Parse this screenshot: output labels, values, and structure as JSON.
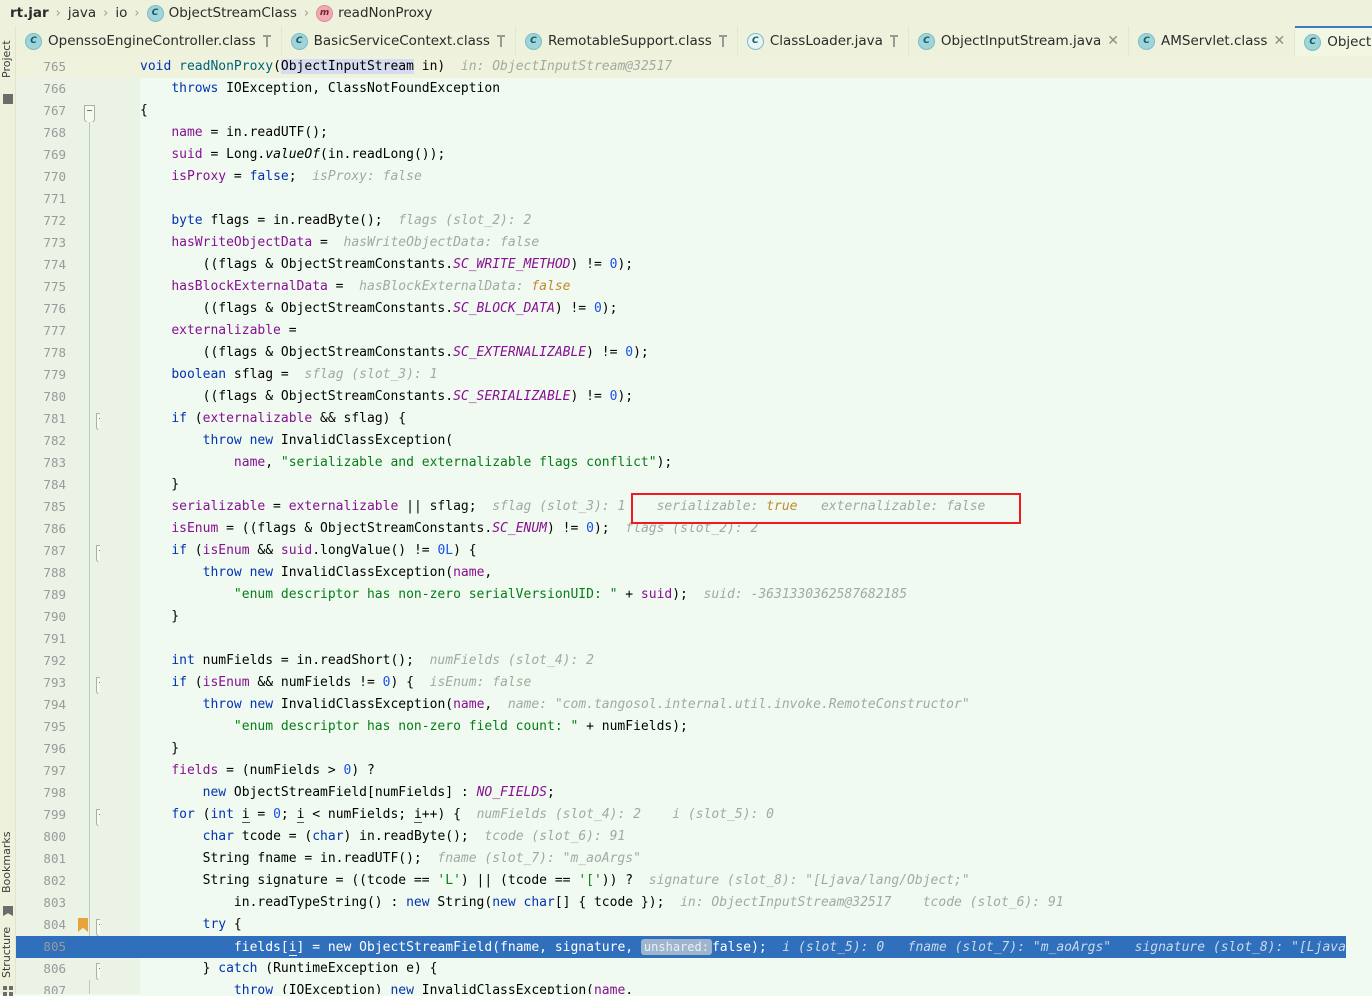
{
  "breadcrumb": {
    "items": [
      {
        "label": "rt.jar",
        "icon": "",
        "bold": true
      },
      {
        "label": "java",
        "icon": "",
        "bold": false
      },
      {
        "label": "io",
        "icon": "",
        "bold": false
      },
      {
        "label": "ObjectStreamClass",
        "icon": "class-icon",
        "bold": false
      },
      {
        "label": "readNonProxy",
        "icon": "method-icon",
        "bold": false
      }
    ],
    "separator": "›"
  },
  "tabs": [
    {
      "label": "OpenssoEngineController.class",
      "icon": "class-icon",
      "state": "pinned",
      "active": false
    },
    {
      "label": "BasicServiceContext.class",
      "icon": "class-icon",
      "state": "pinned",
      "active": false
    },
    {
      "label": "RemotableSupport.class",
      "icon": "class-icon",
      "state": "pinned",
      "active": false
    },
    {
      "label": "ClassLoader.java",
      "icon": "class-icon-outline",
      "state": "pinned",
      "active": false
    },
    {
      "label": "ObjectInputStream.java",
      "icon": "class-icon",
      "state": "closable",
      "active": false
    },
    {
      "label": "AMServlet.class",
      "icon": "class-icon",
      "state": "closable",
      "active": false
    },
    {
      "label": "ObjectStreamC",
      "icon": "class-icon",
      "state": "none",
      "active": true
    }
  ],
  "tool_windows": {
    "left_top": "Project",
    "left_bottom_1": "Bookmarks",
    "left_bottom_2": "Structure"
  },
  "annotations": {
    "red_box": {
      "serializable_label": "serializable: ",
      "serializable_value": "true",
      "externalizable_label": "externalizable: ",
      "externalizable_value": "false",
      "color": "#ee1c20"
    }
  },
  "editor": {
    "selected_line": 805,
    "caret_line": 765,
    "bookmark_line": 804,
    "first_line": 765,
    "last_line": 807,
    "lines": [
      {
        "n": 765,
        "text": "void readNonProxy(ObjectInputStream in)",
        "hints": "in: ObjectInputStream@32517"
      },
      {
        "n": 766,
        "text": "    throws IOException, ClassNotFoundException",
        "hints": ""
      },
      {
        "n": 767,
        "text": "{",
        "hints": ""
      },
      {
        "n": 768,
        "text": "    name = in.readUTF();",
        "hints": ""
      },
      {
        "n": 769,
        "text": "    suid = Long.valueOf(in.readLong());",
        "hints": ""
      },
      {
        "n": 770,
        "text": "    isProxy = false;",
        "hints": "isProxy: false"
      },
      {
        "n": 771,
        "text": "",
        "hints": ""
      },
      {
        "n": 772,
        "text": "    byte flags = in.readByte();",
        "hints": "flags (slot_2): 2"
      },
      {
        "n": 773,
        "text": "    hasWriteObjectData =",
        "hints": "hasWriteObjectData: false"
      },
      {
        "n": 774,
        "text": "        ((flags & ObjectStreamConstants.SC_WRITE_METHOD) != 0);",
        "hints": ""
      },
      {
        "n": 775,
        "text": "    hasBlockExternalData =",
        "hints": "hasBlockExternalData: false"
      },
      {
        "n": 776,
        "text": "        ((flags & ObjectStreamConstants.SC_BLOCK_DATA) != 0);",
        "hints": ""
      },
      {
        "n": 777,
        "text": "    externalizable =",
        "hints": ""
      },
      {
        "n": 778,
        "text": "        ((flags & ObjectStreamConstants.SC_EXTERNALIZABLE) != 0);",
        "hints": ""
      },
      {
        "n": 779,
        "text": "    boolean sflag =",
        "hints": "sflag (slot_3): 1"
      },
      {
        "n": 780,
        "text": "        ((flags & ObjectStreamConstants.SC_SERIALIZABLE) != 0);",
        "hints": ""
      },
      {
        "n": 781,
        "text": "    if (externalizable && sflag) {",
        "hints": ""
      },
      {
        "n": 782,
        "text": "        throw new InvalidClassException(",
        "hints": ""
      },
      {
        "n": 783,
        "text": "            name, \"serializable and externalizable flags conflict\");",
        "hints": ""
      },
      {
        "n": 784,
        "text": "    }",
        "hints": ""
      },
      {
        "n": 785,
        "text": "    serializable = externalizable || sflag;",
        "hints": "sflag (slot_3): 1    serializable: true    externalizable: false"
      },
      {
        "n": 786,
        "text": "    isEnum = ((flags & ObjectStreamConstants.SC_ENUM) != 0);",
        "hints": "flags (slot_2): 2"
      },
      {
        "n": 787,
        "text": "    if (isEnum && suid.longValue() != 0L) {",
        "hints": ""
      },
      {
        "n": 788,
        "text": "        throw new InvalidClassException(name,",
        "hints": ""
      },
      {
        "n": 789,
        "text": "            \"enum descriptor has non-zero serialVersionUID: \" + suid);",
        "hints": "suid: -3631330362587682185"
      },
      {
        "n": 790,
        "text": "    }",
        "hints": ""
      },
      {
        "n": 791,
        "text": "",
        "hints": ""
      },
      {
        "n": 792,
        "text": "    int numFields = in.readShort();",
        "hints": "numFields (slot_4): 2"
      },
      {
        "n": 793,
        "text": "    if (isEnum && numFields != 0) {",
        "hints": "isEnum: false"
      },
      {
        "n": 794,
        "text": "        throw new InvalidClassException(name,",
        "hints": "name: \"com.tangosol.internal.util.invoke.RemoteConstructor\""
      },
      {
        "n": 795,
        "text": "            \"enum descriptor has non-zero field count: \" + numFields);",
        "hints": ""
      },
      {
        "n": 796,
        "text": "    }",
        "hints": ""
      },
      {
        "n": 797,
        "text": "    fields = (numFields > 0) ?",
        "hints": ""
      },
      {
        "n": 798,
        "text": "        new ObjectStreamField[numFields] : NO_FIELDS;",
        "hints": ""
      },
      {
        "n": 799,
        "text": "    for (int i = 0; i < numFields; i++) {",
        "hints": "numFields (slot_4): 2    i (slot_5): 0"
      },
      {
        "n": 800,
        "text": "        char tcode = (char) in.readByte();",
        "hints": "tcode (slot_6): 91"
      },
      {
        "n": 801,
        "text": "        String fname = in.readUTF();",
        "hints": "fname (slot_7): \"m_aoArgs\""
      },
      {
        "n": 802,
        "text": "        String signature = ((tcode == 'L') || (tcode == '[')) ?",
        "hints": "signature (slot_8): \"[Ljava/lang/Object;\""
      },
      {
        "n": 803,
        "text": "            in.readTypeString() : new String(new char[] { tcode });",
        "hints": "in: ObjectInputStream@32517    tcode (slot_6): 91"
      },
      {
        "n": 804,
        "text": "        try {",
        "hints": ""
      },
      {
        "n": 805,
        "text": "            fields[i] = new ObjectStreamField(fname, signature, unshared: false);",
        "hints": "i (slot_5): 0    fname (slot_7): \"m_aoArgs\"    signature (slot_8): \"[Ljava"
      },
      {
        "n": 806,
        "text": "        } catch (RuntimeException e) {",
        "hints": ""
      },
      {
        "n": 807,
        "text": "            throw (IOException) new InvalidClassException(name,",
        "hints": ""
      }
    ]
  },
  "theme": {
    "editor_bg": "#f1faf0",
    "gutter_bg": "#eaf3e6",
    "caret_row_bg": "#eff3dd",
    "selection_bg": "#2f6fbb",
    "tab_bg": "#eef2dc",
    "active_tab_underline": "#3a7bd0",
    "keyword": "#0033b3",
    "string": "#067d17",
    "number": "#1750eb",
    "field": "#871094",
    "inlay_hint": "#a3a9a0",
    "bookmark": "#e8a33d"
  }
}
